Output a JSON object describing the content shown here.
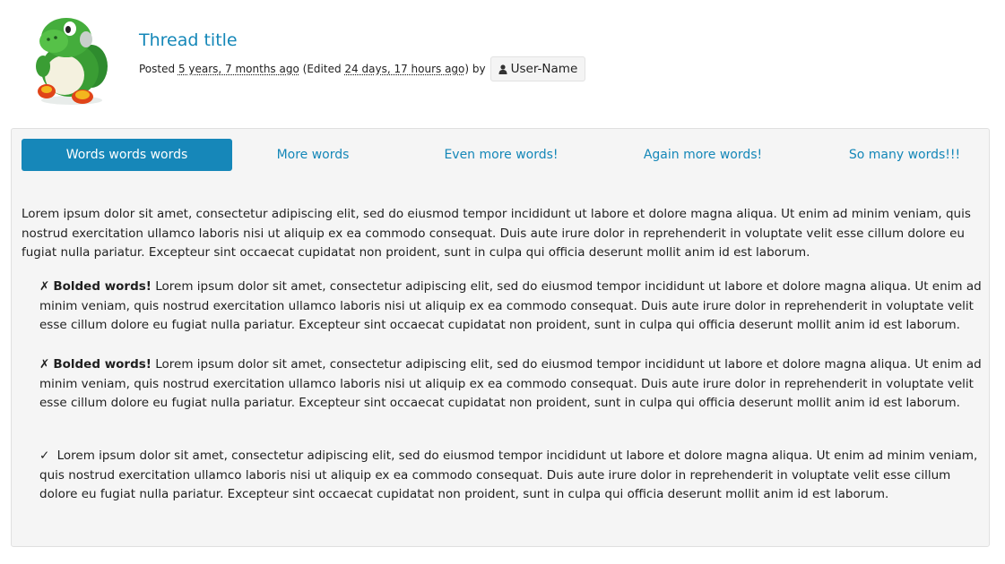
{
  "post": {
    "title": "Thread title",
    "posted_label": "Posted",
    "posted_ago": "5 years, 7 months ago",
    "edited_prefix": "(Edited",
    "edited_ago": "24 days, 17 hours ago",
    "edited_suffix": ")",
    "by_label": "by",
    "author": "User-Name",
    "author_icon": "user-icon",
    "avatar_icon": "green-creature-avatar"
  },
  "tabs": [
    {
      "label": "Words words words",
      "active": true
    },
    {
      "label": "More words",
      "active": false
    },
    {
      "label": "Even more words!",
      "active": false
    },
    {
      "label": "Again more words!",
      "active": false
    },
    {
      "label": "So many words!!!",
      "active": false
    }
  ],
  "content": {
    "intro": "Lorem ipsum dolor sit amet, consectetur adipiscing elit, sed do eiusmod tempor incididunt ut labore et dolore magna aliqua. Ut enim ad minim veniam, quis nostrud exercitation ullamco laboris nisi ut aliquip ex ea commodo consequat. Duis aute irure dolor in reprehenderit in voluptate velit esse cillum dolore eu fugiat nulla pariatur. Excepteur sint occaecat cupidatat non proident, sunt in culpa qui officia deserunt mollit anim id est laborum.",
    "items": [
      {
        "mark": "✗",
        "bold": "Bolded words!",
        "text": " Lorem ipsum dolor sit amet, consectetur adipiscing elit, sed do eiusmod tempor incididunt ut labore et dolore magna aliqua. Ut enim ad minim veniam, quis nostrud exercitation ullamco laboris nisi ut aliquip ex ea commodo consequat. Duis aute irure dolor in reprehenderit in voluptate velit esse cillum dolore eu fugiat nulla pariatur. Excepteur sint occaecat cupidatat non proident, sunt in culpa qui officia deserunt mollit anim id est laborum."
      },
      {
        "mark": "✗",
        "bold": "Bolded words!",
        "text": " Lorem ipsum dolor sit amet, consectetur adipiscing elit, sed do eiusmod tempor incididunt ut labore et dolore magna aliqua. Ut enim ad minim veniam, quis nostrud exercitation ullamco laboris nisi ut aliquip ex ea commodo consequat. Duis aute irure dolor in reprehenderit in voluptate velit esse cillum dolore eu fugiat nulla pariatur. Excepteur sint occaecat cupidatat non proident, sunt in culpa qui officia deserunt mollit anim id est laborum."
      },
      {
        "mark": "✓",
        "bold": "",
        "text": " Lorem ipsum dolor sit amet, consectetur adipiscing elit, sed do eiusmod tempor incididunt ut labore et dolore magna aliqua. Ut enim ad minim veniam, quis nostrud exercitation ullamco laboris nisi ut aliquip ex ea commodo consequat. Duis aute irure dolor in reprehenderit in voluptate velit esse cillum dolore eu fugiat nulla pariatur. Excepteur sint occaecat cupidatat non proident, sunt in culpa qui officia deserunt mollit anim id est laborum."
      }
    ]
  },
  "colors": {
    "accent": "#1687b9",
    "link": "#1487b8",
    "panel_bg": "#f5f5f5"
  }
}
